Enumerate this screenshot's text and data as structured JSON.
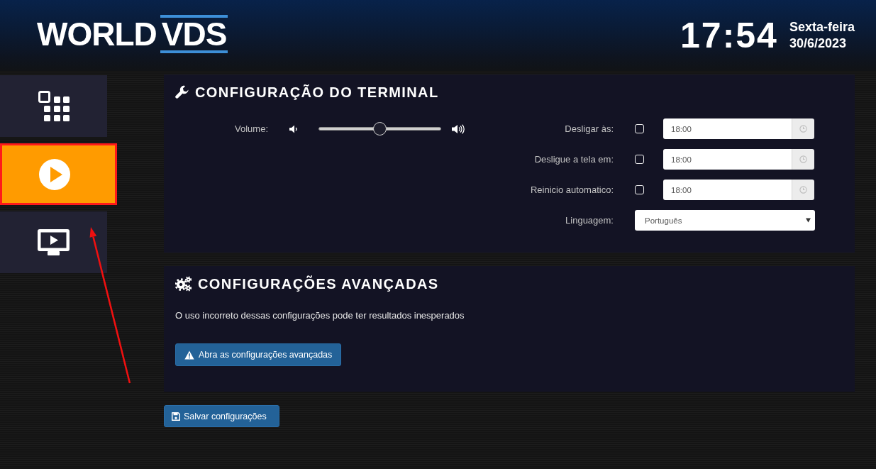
{
  "header": {
    "logo": {
      "word": "WORLD",
      "accent": "VDS"
    },
    "clock": {
      "time": "17:54",
      "weekday": "Sexta-feira",
      "date": "30/6/2023"
    }
  },
  "sidebar": {
    "items": [
      {
        "selected": false,
        "highlighted": false
      },
      {
        "selected": true,
        "highlighted": true
      },
      {
        "selected": false,
        "highlighted": false
      }
    ]
  },
  "terminal_settings": {
    "title": "CONFIGURAÇÃO DO TERMINAL",
    "volume": {
      "label": "Volume:",
      "level": 0.5
    },
    "schedule": [
      {
        "label": "Desligar às:",
        "checked": false,
        "value": "18:00"
      },
      {
        "label": "Desligue a tela em:",
        "checked": false,
        "value": "18:00"
      },
      {
        "label": "Reinicio automatico:",
        "checked": false,
        "value": "18:00"
      }
    ],
    "language": {
      "label": "Linguagem:",
      "value": "Português"
    }
  },
  "advanced_settings": {
    "title": "CONFIGURAÇÕES AVANÇADAS",
    "warning": "O uso incorreto dessas configurações pode ter resultados inesperados",
    "button": "Abra as configurações avançadas"
  },
  "save_button": "Salvar configurações",
  "annotation_arrow": true
}
